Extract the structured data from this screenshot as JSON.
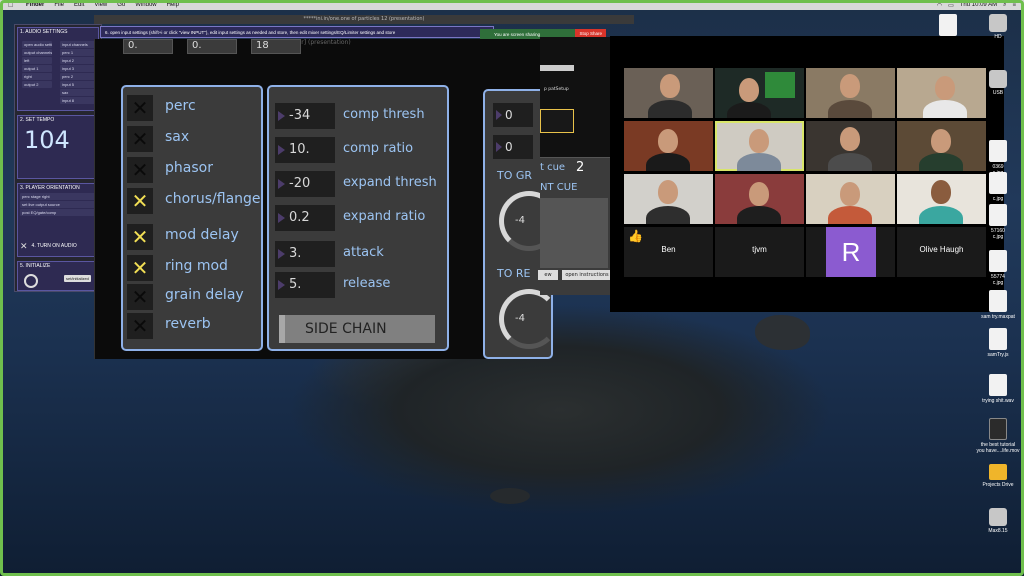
{
  "menubar": {
    "apple": "",
    "items": [
      "Finder",
      "File",
      "Edit",
      "View",
      "Go",
      "Window",
      "Help"
    ],
    "clock": "Thu 10:09 AM"
  },
  "control_panel": {
    "audio_settings": {
      "title": "1. AUDIO SETTINGS",
      "open_label": "open audio settings",
      "input_channels": "input channels",
      "inputs": [
        "perc 1",
        "input 2",
        "input 3",
        "perc 2",
        "input 5",
        "sax",
        "input 8"
      ],
      "output_channels": "output channels",
      "left": "left",
      "output1": "output 1",
      "right": "right",
      "output2": "output 2"
    },
    "tempo": {
      "title": "2. SET TEMPO",
      "value": "104"
    },
    "orientation": {
      "title": "3. PLAYER ORIENTATION",
      "select": "perc stage right",
      "live_output": "set live output source",
      "post": "post EQ/gate/comp"
    },
    "audio_on": {
      "title": "4. TURN ON AUDIO"
    },
    "initialize": {
      "title": "5. INITIALIZE",
      "button": "set/initialized"
    }
  },
  "patch": {
    "window_title": "*****ini.in/one.one of particles 12 (presentation)",
    "instructions": "6. open input settings (shift+i or click \"view INPUT\"), edit input settings as needed and store, then edit mixer settings/EQ/Limiter settings and store",
    "subtitle": "[slider] (presentation)",
    "top_boxes": [
      "0.",
      "0.",
      "18"
    ],
    "effects": [
      {
        "label": "perc",
        "on": false
      },
      {
        "label": "sax",
        "on": false
      },
      {
        "label": "phasor",
        "on": false
      },
      {
        "label": "chorus/flange",
        "on": true
      },
      {
        "label": "mod delay",
        "on": true
      },
      {
        "label": "ring mod",
        "on": true
      },
      {
        "label": "grain delay",
        "on": false
      },
      {
        "label": "reverb",
        "on": false
      }
    ],
    "dynamics": [
      {
        "value": "-34",
        "label": "comp thresh"
      },
      {
        "value": "10.",
        "label": "comp ratio"
      },
      {
        "value": "-20",
        "label": "expand thresh"
      },
      {
        "value": "0.2",
        "label": "expand ratio"
      },
      {
        "value": "3.",
        "label": "attack"
      },
      {
        "value": "5.",
        "label": "release"
      }
    ],
    "side_chain": "SIDE CHAIN",
    "right_values": [
      "0",
      "0"
    ],
    "to_gr": "TO GR",
    "to_re": "TO RE",
    "dial1": "-4",
    "dial2": "-4"
  },
  "sub_window": {
    "button": "p patSetup",
    "cue_a": "t cue",
    "cue_num": "2",
    "cue_b": "NT CUE",
    "btn1": "ew",
    "btn2": "open instructions"
  },
  "screen_share": {
    "status": "You are screen sharing",
    "stop": "Stop Share"
  },
  "zoom": {
    "name_tiles": [
      "Ben",
      "tjvm",
      "Olive Haugh"
    ],
    "avatar_letter": "R",
    "reaction": "👍"
  },
  "desktop_icons": [
    {
      "label": "",
      "kind": "doc"
    },
    {
      "label": "HD",
      "kind": "drive"
    },
    {
      "label": "USB",
      "kind": "drive"
    },
    {
      "label": "0369\nc.jpg",
      "kind": "doc"
    },
    {
      "label": "c.jpg",
      "kind": "doc"
    },
    {
      "label": "57160\nc.jpg",
      "kind": "doc"
    },
    {
      "label": "55774\nc.jpg",
      "kind": "doc"
    },
    {
      "label": "sam try.maxpat",
      "kind": "doc"
    },
    {
      "label": "samTry.js",
      "kind": "doc"
    },
    {
      "label": "trying shit.wav",
      "kind": "doc"
    },
    {
      "label": "the best tutorial\nyou have....life.mov",
      "kind": "movie"
    },
    {
      "label": "Projects Drive",
      "kind": "folder"
    },
    {
      "label": "Max8.15",
      "kind": "drive"
    }
  ],
  "colors": {
    "accent_blue": "#9cc4f2",
    "toggle_on": "#f1de54",
    "panel_border": "#8fb1e8",
    "zoom_avatar": "#8b5bd0",
    "share_green": "#2f6f3a",
    "stop_red": "#d8342a"
  }
}
